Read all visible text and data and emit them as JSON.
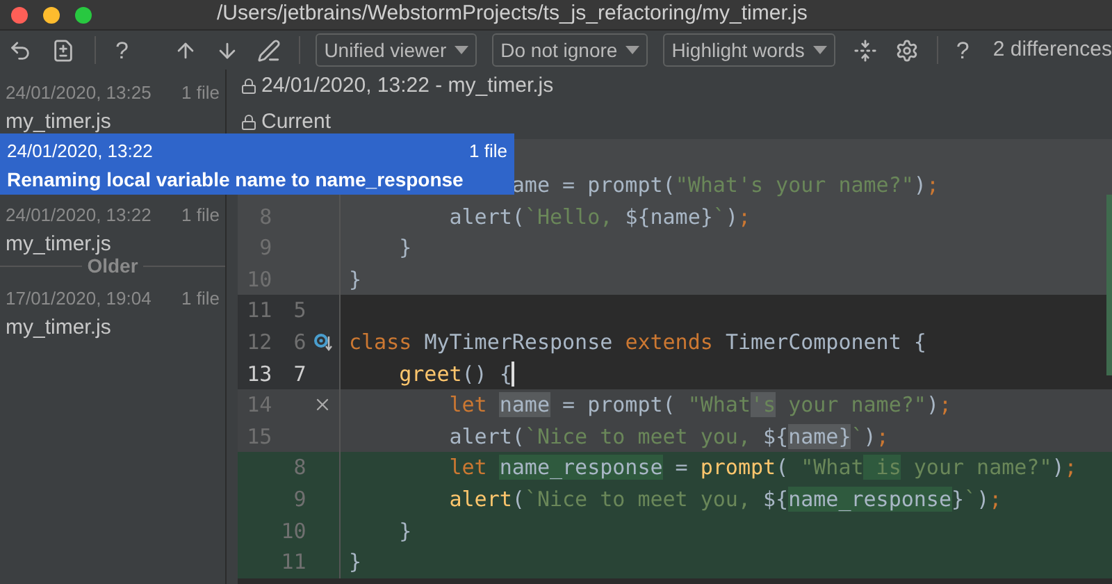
{
  "window": {
    "title": "/Users/jetbrains/WebstormProjects/ts_js_refactoring/my_timer.js"
  },
  "toolbar_left": {
    "help": "?"
  },
  "toolbar_right": {
    "dropdowns": [
      "Unified viewer",
      "Do not ignore",
      "Highlight words"
    ],
    "help": "?",
    "differences": "2 differences"
  },
  "history": [
    {
      "kind": "entry",
      "date": "24/01/2020, 13:25",
      "count": "1 file",
      "label": "my_timer.js",
      "selected": false
    },
    {
      "kind": "entry",
      "date": "24/01/2020, 13:22",
      "count": "1 file",
      "label": "Renaming local variable name to name_response",
      "selected": true
    },
    {
      "kind": "entry",
      "date": "24/01/2020, 13:22",
      "count": "1 file",
      "label": "my_timer.js",
      "selected": false
    },
    {
      "kind": "separator",
      "label": "Older"
    },
    {
      "kind": "entry",
      "date": "17/01/2020, 19:04",
      "count": "1 file",
      "label": "my_timer.js",
      "selected": false
    }
  ],
  "header": {
    "revision": "24/01/2020, 13:22 - my_timer.js",
    "current": "Current"
  },
  "code": [
    {
      "kind": "context",
      "segments": [
        {
          "kind": "plain",
          "text": "             ame = prompt("
        },
        {
          "kind": "string",
          "text": "\"What's your name?\""
        },
        {
          "kind": "plain",
          "text": ")"
        },
        {
          "kind": "keyword",
          "text": ";"
        }
      ]
    },
    {
      "kind": "context",
      "old": "8",
      "current": false,
      "segments": [
        {
          "kind": "plain",
          "text": "        alert("
        },
        {
          "kind": "string",
          "text": "`Hello, "
        },
        {
          "kind": "plain",
          "text": "${name}"
        },
        {
          "kind": "string",
          "text": "`"
        },
        {
          "kind": "plain",
          "text": ")"
        },
        {
          "kind": "keyword",
          "text": ";"
        }
      ]
    },
    {
      "kind": "context",
      "old": "9",
      "current": false,
      "segments": [
        {
          "kind": "plain",
          "text": "    }"
        }
      ]
    },
    {
      "kind": "context",
      "old": "10",
      "current": false,
      "segments": [
        {
          "kind": "plain",
          "text": "}"
        }
      ]
    },
    {
      "kind": "plain",
      "old": "11",
      "new": "5",
      "current": false
    },
    {
      "kind": "plain",
      "old": "12",
      "new": "6",
      "gutter_icon": {
        "kind": "implements"
      },
      "current": false,
      "segments": [
        {
          "kind": "keyword",
          "text": "class "
        },
        {
          "kind": "plain",
          "text": "MyTimerResponse "
        },
        {
          "kind": "keyword",
          "text": "extends "
        },
        {
          "kind": "plain",
          "text": "TimerComponent {"
        }
      ]
    },
    {
      "kind": "plain",
      "old": "13",
      "new": "7",
      "current": true,
      "segments": [
        {
          "kind": "function",
          "text": "    greet"
        },
        {
          "kind": "plain",
          "text": "() {",
          "cursor": true
        }
      ]
    },
    {
      "kind": "deleted",
      "old": "14",
      "gutter_icon": {
        "kind": "revert"
      },
      "current": false,
      "segments": [
        {
          "kind": "keyword",
          "text": "        let "
        },
        {
          "kind": "plain",
          "text": "name",
          "changed": true
        },
        {
          "kind": "plain",
          "text": " = prompt( "
        },
        {
          "kind": "string",
          "text": "\"What"
        },
        {
          "kind": "string",
          "text": "'s",
          "changed": true
        },
        {
          "kind": "string",
          "text": " your name?\""
        },
        {
          "kind": "plain",
          "text": ")"
        },
        {
          "kind": "keyword",
          "text": ";"
        }
      ]
    },
    {
      "kind": "deleted",
      "old": "15",
      "current": false,
      "segments": [
        {
          "kind": "plain",
          "text": "        alert("
        },
        {
          "kind": "string",
          "text": "`Nice to meet you, "
        },
        {
          "kind": "plain",
          "text": "${"
        },
        {
          "kind": "plain",
          "text": "name}",
          "changed": true
        },
        {
          "kind": "string",
          "text": "`"
        },
        {
          "kind": "plain",
          "text": ")"
        },
        {
          "kind": "keyword",
          "text": ";"
        }
      ]
    },
    {
      "kind": "inserted",
      "new": "8",
      "current": false,
      "segments": [
        {
          "kind": "keyword",
          "text": "        let "
        },
        {
          "kind": "plain",
          "text": "name_response",
          "changed": true
        },
        {
          "kind": "plain",
          "text": " = "
        },
        {
          "kind": "function",
          "text": "prompt"
        },
        {
          "kind": "plain",
          "text": "( "
        },
        {
          "kind": "string",
          "text": "\"What"
        },
        {
          "kind": "string",
          "text": " is",
          "changed": true
        },
        {
          "kind": "string",
          "text": " your name?\""
        },
        {
          "kind": "plain",
          "text": ")"
        },
        {
          "kind": "keyword",
          "text": ";"
        }
      ]
    },
    {
      "kind": "inserted",
      "new": "9",
      "current": false,
      "segments": [
        {
          "kind": "function",
          "text": "        alert"
        },
        {
          "kind": "plain",
          "text": "("
        },
        {
          "kind": "string",
          "text": "`Nice to meet you, "
        },
        {
          "kind": "plain",
          "text": "${"
        },
        {
          "kind": "plain",
          "text": "name_response",
          "changed": true
        },
        {
          "kind": "plain",
          "text": "}"
        },
        {
          "kind": "string",
          "text": "`"
        },
        {
          "kind": "plain",
          "text": ")"
        },
        {
          "kind": "keyword",
          "text": ";"
        }
      ]
    },
    {
      "kind": "inserted",
      "new": "10",
      "current": false,
      "segments": [
        {
          "kind": "plain",
          "text": "    }"
        }
      ]
    },
    {
      "kind": "inserted",
      "new": "11",
      "current": false,
      "segments": [
        {
          "kind": "plain",
          "text": "}"
        }
      ]
    }
  ]
}
